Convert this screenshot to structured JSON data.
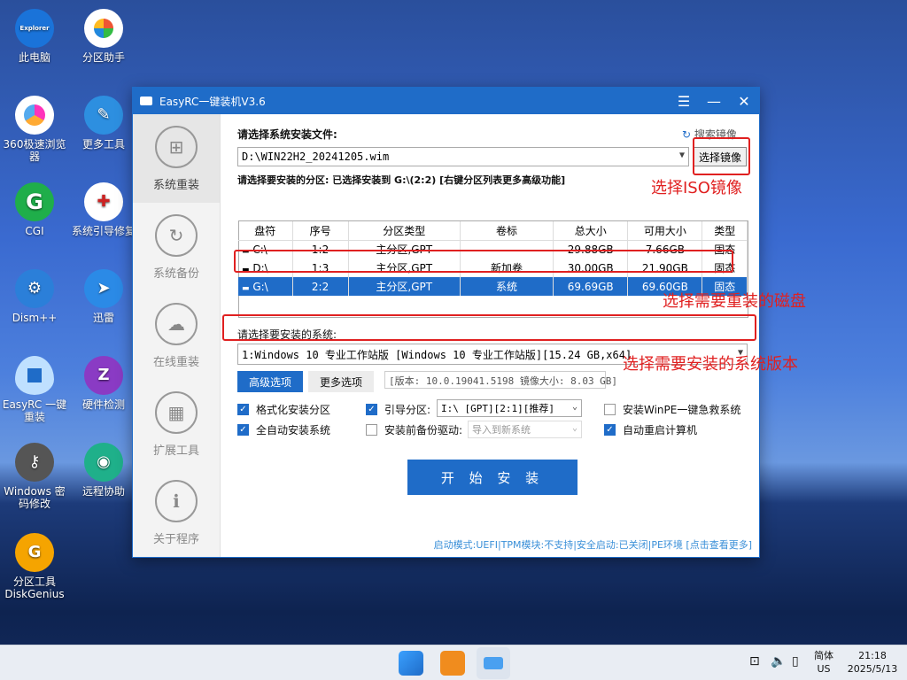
{
  "desktop": {
    "icons": [
      {
        "label": "此电脑",
        "badge": "Explorer"
      },
      {
        "label": "分区助手"
      },
      {
        "label": "360极速浏览器"
      },
      {
        "label": "更多工具"
      },
      {
        "label": "CGI",
        "badge": "G"
      },
      {
        "label": "系统引导修复"
      },
      {
        "label": "Dism++"
      },
      {
        "label": "迅雷"
      },
      {
        "label": "EasyRC 一键重装"
      },
      {
        "label": "硬件检测",
        "badge": "Z"
      },
      {
        "label": "Windows 密码修改"
      },
      {
        "label": "远程协助"
      },
      {
        "label": "分区工具 DiskGenius"
      }
    ]
  },
  "window": {
    "title": "EasyRC一键装机V3.6",
    "sidebar": [
      {
        "label": "系统重装"
      },
      {
        "label": "系统备份"
      },
      {
        "label": "在线重装"
      },
      {
        "label": "扩展工具"
      },
      {
        "label": "关于程序"
      }
    ],
    "file_label": "请选择系统安装文件:",
    "search_link": "搜索镜像",
    "file_path": "D:\\WIN22H2_20241205.wim",
    "select_image_button": "选择镜像",
    "partition_label": "请选择要安装的分区: 已选择安装到 G:\\(2:2) [右键分区列表更多高级功能]",
    "table": {
      "headers": [
        "盘符",
        "序号",
        "分区类型",
        "卷标",
        "总大小",
        "可用大小",
        "类型"
      ],
      "rows": [
        [
          "C:\\",
          "1:2",
          "主分区,GPT",
          "",
          "29.88GB",
          "7.66GB",
          "固态"
        ],
        [
          "D:\\",
          "1:3",
          "主分区,GPT",
          "新加卷",
          "30.00GB",
          "21.90GB",
          "固态"
        ],
        [
          "G:\\",
          "2:2",
          "主分区,GPT",
          "系统",
          "69.69GB",
          "69.60GB",
          "固态"
        ]
      ]
    },
    "system_label": "请选择要安装的系统:",
    "system_value": "1:Windows 10 专业工作站版 [Windows 10 专业工作站版][15.24 GB,x64]",
    "tabs": {
      "advanced": "高级选项",
      "more": "更多选项"
    },
    "version_info": "[版本: 10.0.19041.5198 镜像大小: 8.03 GB]",
    "options": {
      "format": "格式化安装分区",
      "auto": "全自动安装系统",
      "boot": "引导分区:",
      "boot_value": "I:\\ [GPT][2:1][推荐]",
      "backup_driver": "安装前备份驱动:",
      "backup_value": "导入到新系统",
      "winpe": "安装WinPE一键急救系统",
      "restart": "自动重启计算机"
    },
    "start_button": "开 始 安 装",
    "status": "启动模式:UEFI|TPM模块:不支持|安全启动:已关闭|PE环境 [点击查看更多]"
  },
  "annotations": {
    "iso": "选择ISO镜像",
    "disk": "选择需要重装的磁盘",
    "version": "选择需要安装的系统版本"
  },
  "taskbar": {
    "ime": "简体",
    "locale": "US",
    "time": "21:18",
    "date": "2025/5/13"
  }
}
